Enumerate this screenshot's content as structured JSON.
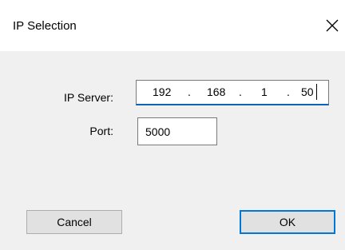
{
  "window": {
    "title": "IP Selection",
    "close_icon": "close-icon"
  },
  "form": {
    "ip_label": "IP Server:",
    "ip_octets": [
      "192",
      "168",
      "1",
      "50"
    ],
    "ip_separator": ".",
    "port_label": "Port:",
    "port_value": "5000"
  },
  "buttons": {
    "cancel_label": "Cancel",
    "ok_label": "OK"
  },
  "colors": {
    "dialog_background": "#f0f0f0",
    "title_background": "#ffffff",
    "focus_accent": "#0078d7"
  }
}
